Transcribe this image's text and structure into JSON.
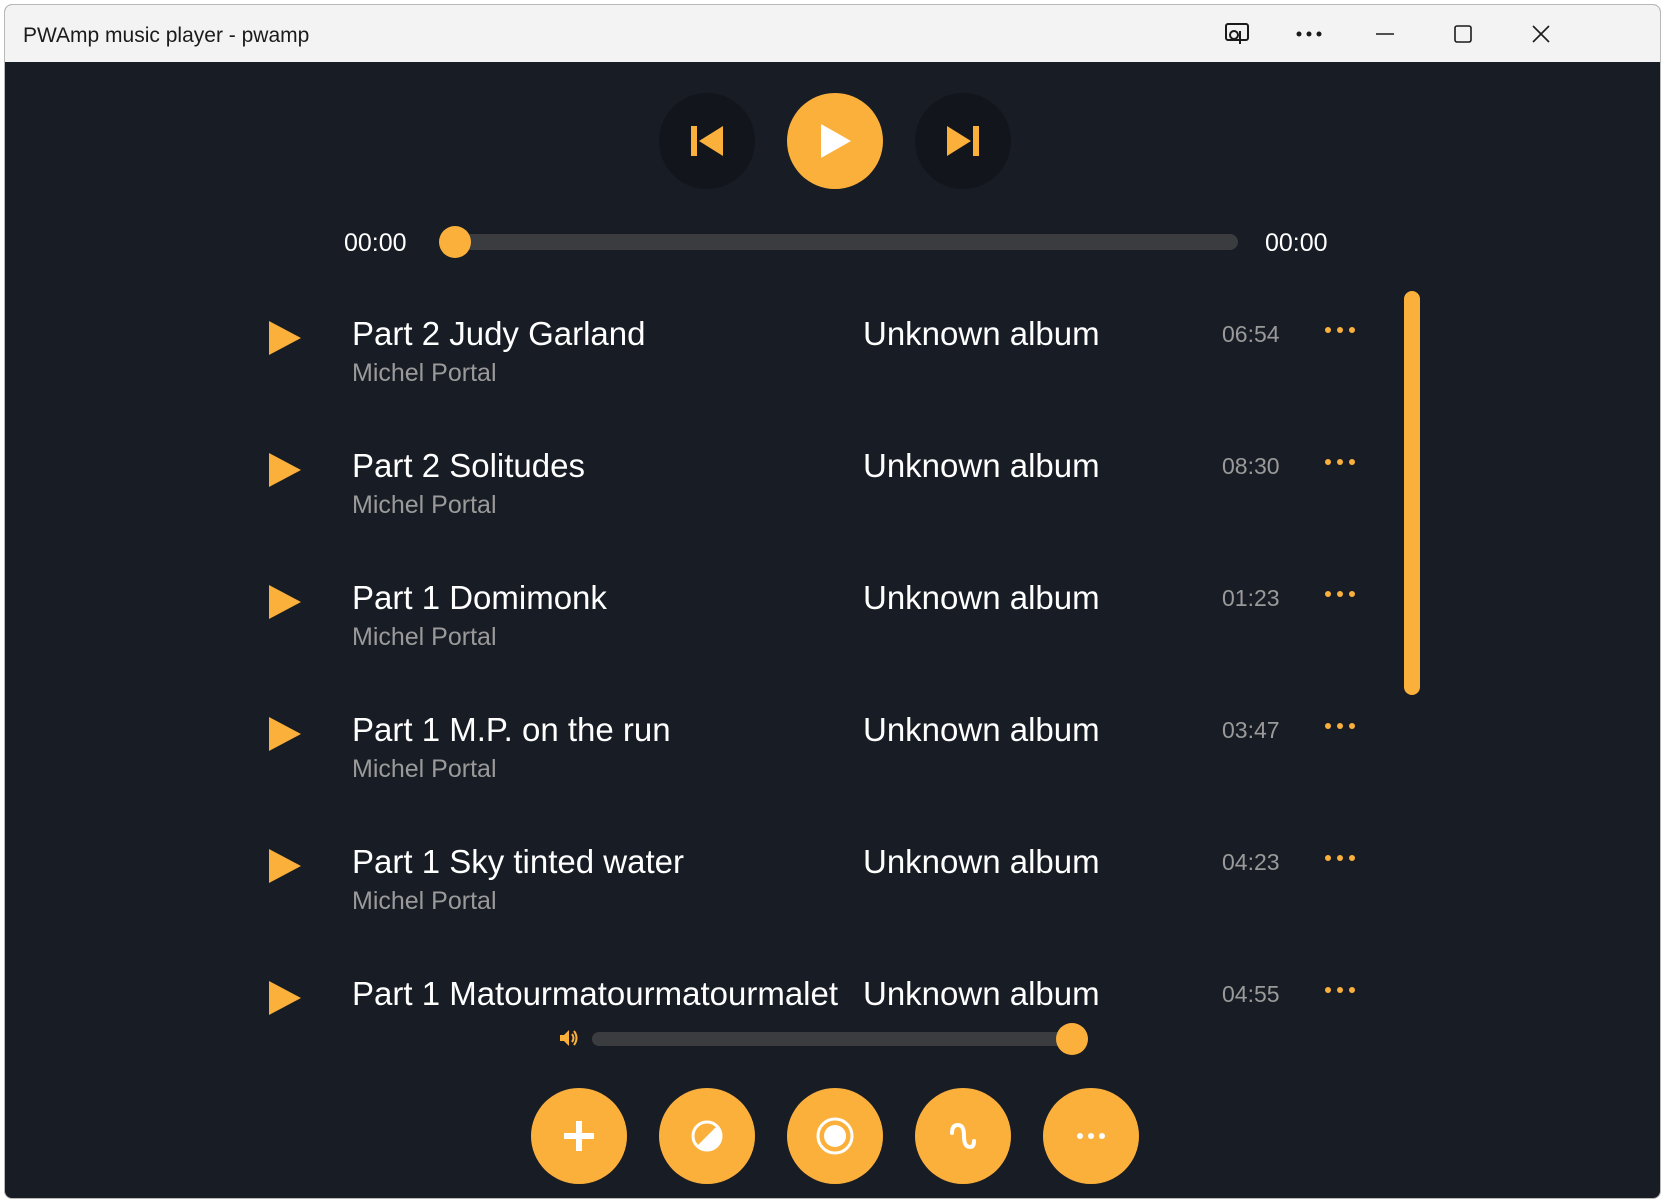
{
  "window": {
    "title": "PWAmp music player - pwamp",
    "controls": [
      "cast-icon",
      "more-icon",
      "minimize-icon",
      "maximize-icon",
      "close-icon"
    ]
  },
  "colors": {
    "accent": "#fbb03b",
    "background": "#181c24",
    "track": "#3a3c40",
    "text_primary": "#ffffff",
    "text_secondary": "#9a9a9a"
  },
  "player": {
    "current_time": "00:00",
    "total_time": "00:00",
    "progress": 0,
    "volume": 1.0
  },
  "playlist": [
    {
      "title": "Part 2 Judy Garland",
      "artist": "Michel Portal",
      "album": "Unknown album",
      "duration": "06:54"
    },
    {
      "title": "Part 2 Solitudes",
      "artist": "Michel Portal",
      "album": "Unknown album",
      "duration": "08:30"
    },
    {
      "title": "Part 1 Domimonk",
      "artist": "Michel Portal",
      "album": "Unknown album",
      "duration": "01:23"
    },
    {
      "title": "Part 1 M.P. on the run",
      "artist": "Michel Portal",
      "album": "Unknown album",
      "duration": "03:47"
    },
    {
      "title": "Part 1 Sky tinted water",
      "artist": "Michel Portal",
      "album": "Unknown album",
      "duration": "04:23"
    },
    {
      "title": "Part 1 Matourmatourmatourmalet",
      "artist": "",
      "album": "Unknown album",
      "duration": "04:55"
    }
  ],
  "bottom_buttons": [
    "add-icon",
    "theme-icon",
    "record-icon",
    "visualizer-icon",
    "more-options-icon"
  ]
}
